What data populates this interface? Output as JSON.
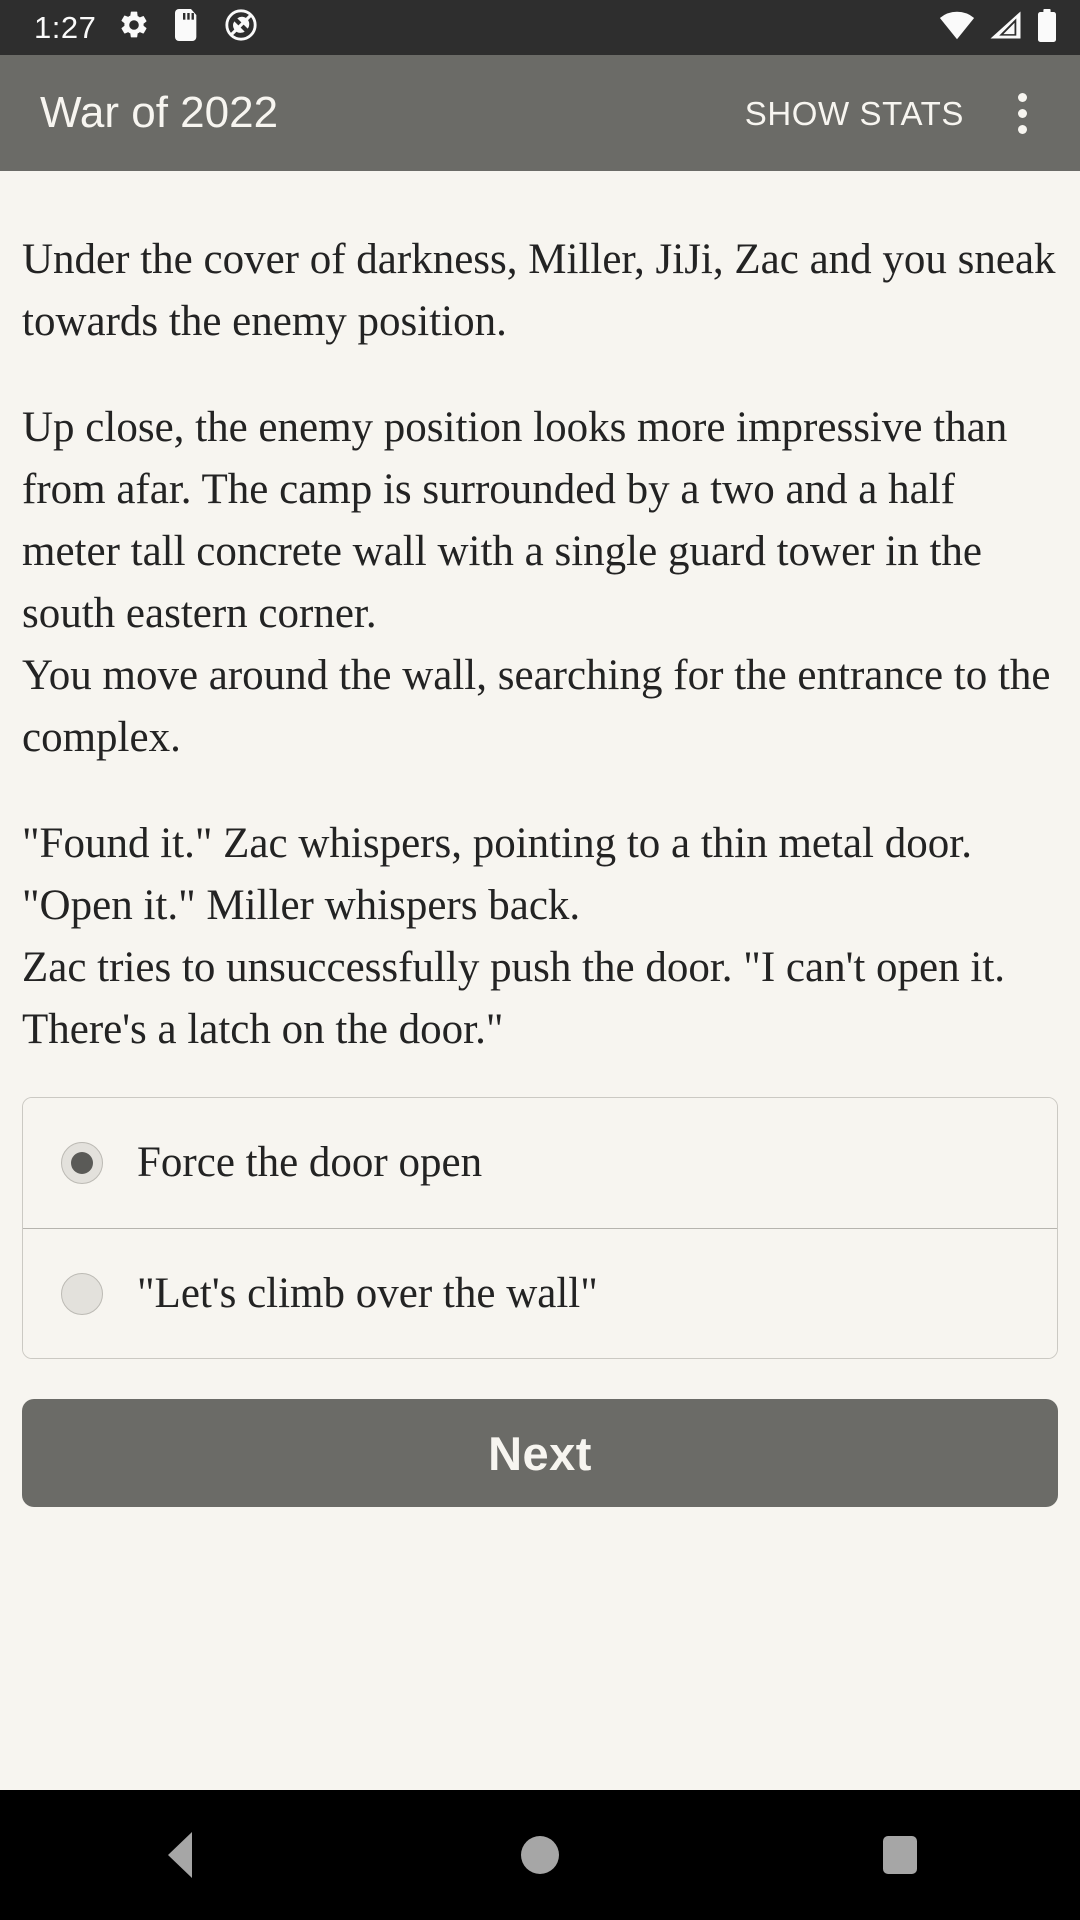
{
  "status_bar": {
    "time": "1:27",
    "left_icons": [
      "gear-icon",
      "sd-card-icon",
      "silent-mode-icon"
    ],
    "right_icons": [
      "wifi-icon",
      "cellular-signal-icon",
      "battery-icon"
    ],
    "background_color": "#2e2e2e",
    "foreground_color": "#fafafa"
  },
  "app_bar": {
    "title": "War of 2022",
    "action_label": "SHOW STATS",
    "overflow_icon": "more-vert-icon",
    "background_color": "#6b6b67",
    "text_color": "#f7f5f0"
  },
  "story": {
    "paragraphs": [
      "Under the cover of darkness, Miller, JiJi, Zac and you sneak towards the enemy position.",
      "Up close, the enemy position looks more impressive than from afar. The camp is surrounded by a two and a half meter tall concrete wall with a single guard tower in the south eastern corner.\nYou move around the wall, searching for the entrance to the complex.",
      "\"Found it.\" Zac whispers, pointing to a thin metal door.\n\"Open it.\" Miller whispers back.\nZac tries to unsuccessfully push the door. \"I can't open it. There's a latch on the door.\""
    ],
    "text_color": "#232323",
    "background_color": "#f7f5f0"
  },
  "options": {
    "selected_index": 0,
    "items": [
      {
        "label": "Force the door open",
        "selected": true
      },
      {
        "label": "\"Let's climb over the wall\"",
        "selected": false
      }
    ]
  },
  "next_button": {
    "label": "Next",
    "background_color": "#6b6b67",
    "text_color": "#f7f5f0"
  },
  "nav_bar": {
    "background_color": "#000000",
    "icon_color": "#a6a6a6",
    "buttons": [
      {
        "name": "back-icon"
      },
      {
        "name": "home-icon"
      },
      {
        "name": "recents-icon"
      }
    ]
  }
}
